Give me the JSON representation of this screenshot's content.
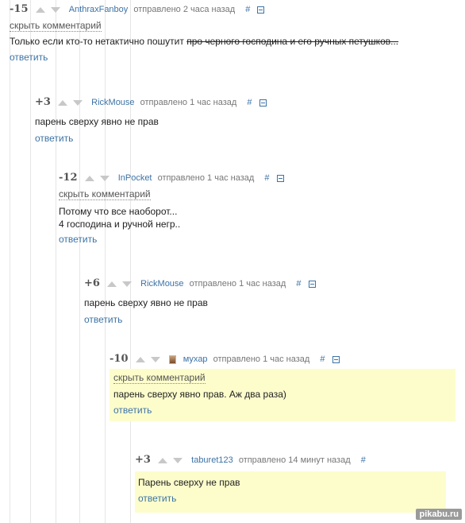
{
  "comments": [
    {
      "score": "-15",
      "author": "AnthraxFanboy",
      "meta": "отправлено 2 часа назад",
      "hash": "#",
      "hide": "скрыть комментарий",
      "text_plain": "Только если кто-то нетактично пошутит",
      "text_strike": "про черного господина и его ручных петушков...",
      "reply": "ответить"
    },
    {
      "score": "+3",
      "author": "RickMouse",
      "meta": "отправлено 1 час назад",
      "hash": "#",
      "text": "парень сверху явно не прав",
      "reply": "ответить"
    },
    {
      "score": "-12",
      "author": "InPocket",
      "meta": "отправлено 1 час назад",
      "hash": "#",
      "hide": "скрыть комментарий",
      "line1": "Потому что все наоборот...",
      "line2": "4 господина и ручной негр..",
      "reply": "ответить"
    },
    {
      "score": "+6",
      "author": "RickMouse",
      "meta": "отправлено 1 час назад",
      "hash": "#",
      "text": "парень сверху явно не прав",
      "reply": "ответить"
    },
    {
      "score": "-10",
      "author": "мухар",
      "meta": "отправлено 1 час назад",
      "hash": "#",
      "hide": "скрыть комментарий",
      "text": "парень сверху явно прав. Аж два раза)",
      "reply": "ответить"
    },
    {
      "score": "+3",
      "author": "taburet123",
      "meta": "отправлено 14 минут назад",
      "hash": "#",
      "text": "Парень сверху не прав",
      "reply": "ответить"
    }
  ],
  "watermark": "pikabu.ru",
  "colors": {
    "link": "#3d73a6",
    "highlight": "#fdfdcc",
    "score": "#555555"
  }
}
